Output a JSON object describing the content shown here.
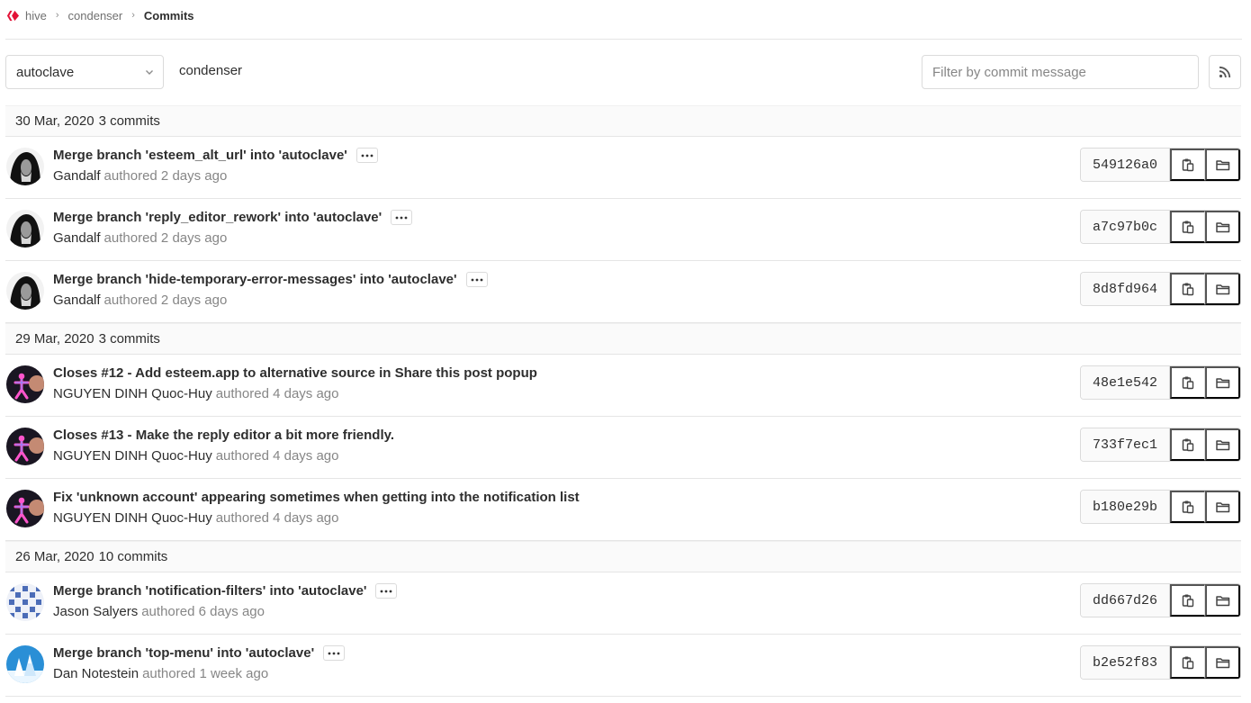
{
  "breadcrumb": {
    "items": [
      "hive",
      "condenser",
      "Commits"
    ]
  },
  "toolbar": {
    "branch": "autoclave",
    "repo": "condenser",
    "filter_placeholder": "Filter by commit message"
  },
  "days": [
    {
      "date": "30 Mar, 2020",
      "count": "3 commits",
      "commits": [
        {
          "title": "Merge branch 'esteem_alt_url' into 'autoclave'",
          "author": "Gandalf",
          "when": "authored 2 days ago",
          "sha": "549126a0",
          "avatar": "gandalf",
          "has_ellipsis": true
        },
        {
          "title": "Merge branch 'reply_editor_rework' into 'autoclave'",
          "author": "Gandalf",
          "when": "authored 2 days ago",
          "sha": "a7c97b0c",
          "avatar": "gandalf",
          "has_ellipsis": true
        },
        {
          "title": "Merge branch 'hide-temporary-error-messages' into 'autoclave'",
          "author": "Gandalf",
          "when": "authored 2 days ago",
          "sha": "8d8fd964",
          "avatar": "gandalf",
          "has_ellipsis": true
        }
      ]
    },
    {
      "date": "29 Mar, 2020",
      "count": "3 commits",
      "commits": [
        {
          "title": "Closes #12 - Add esteem.app to alternative source in Share this post popup",
          "author": "NGUYEN DINH Quoc-Huy",
          "when": "authored 4 days ago",
          "sha": "48e1e542",
          "avatar": "nguyen",
          "has_ellipsis": false
        },
        {
          "title": "Closes #13 - Make the reply editor a bit more friendly.",
          "author": "NGUYEN DINH Quoc-Huy",
          "when": "authored 4 days ago",
          "sha": "733f7ec1",
          "avatar": "nguyen",
          "has_ellipsis": false
        },
        {
          "title": "Fix 'unknown account' appearing sometimes when getting into the notification list",
          "author": "NGUYEN DINH Quoc-Huy",
          "when": "authored 4 days ago",
          "sha": "b180e29b",
          "avatar": "nguyen",
          "has_ellipsis": false
        }
      ]
    },
    {
      "date": "26 Mar, 2020",
      "count": "10 commits",
      "commits": [
        {
          "title": "Merge branch 'notification-filters' into 'autoclave'",
          "author": "Jason Salyers",
          "when": "authored 6 days ago",
          "sha": "dd667d26",
          "avatar": "jason",
          "has_ellipsis": true
        },
        {
          "title": "Merge branch 'top-menu' into 'autoclave'",
          "author": "Dan Notestein",
          "when": "authored 1 week ago",
          "sha": "b2e52f83",
          "avatar": "dan",
          "has_ellipsis": true
        }
      ]
    }
  ],
  "icons": {
    "brand": "hive-logo-icon",
    "breadcrumb_separator": "chevron-right-icon",
    "dropdown": "chevron-down-icon",
    "rss": "rss-icon",
    "more": "ellipsis-icon",
    "copy": "clipboard-icon",
    "browse": "folder-icon"
  },
  "colors": {
    "brand_red": "#e31337",
    "border": "#dbdbdb",
    "muted_text": "#868686"
  }
}
